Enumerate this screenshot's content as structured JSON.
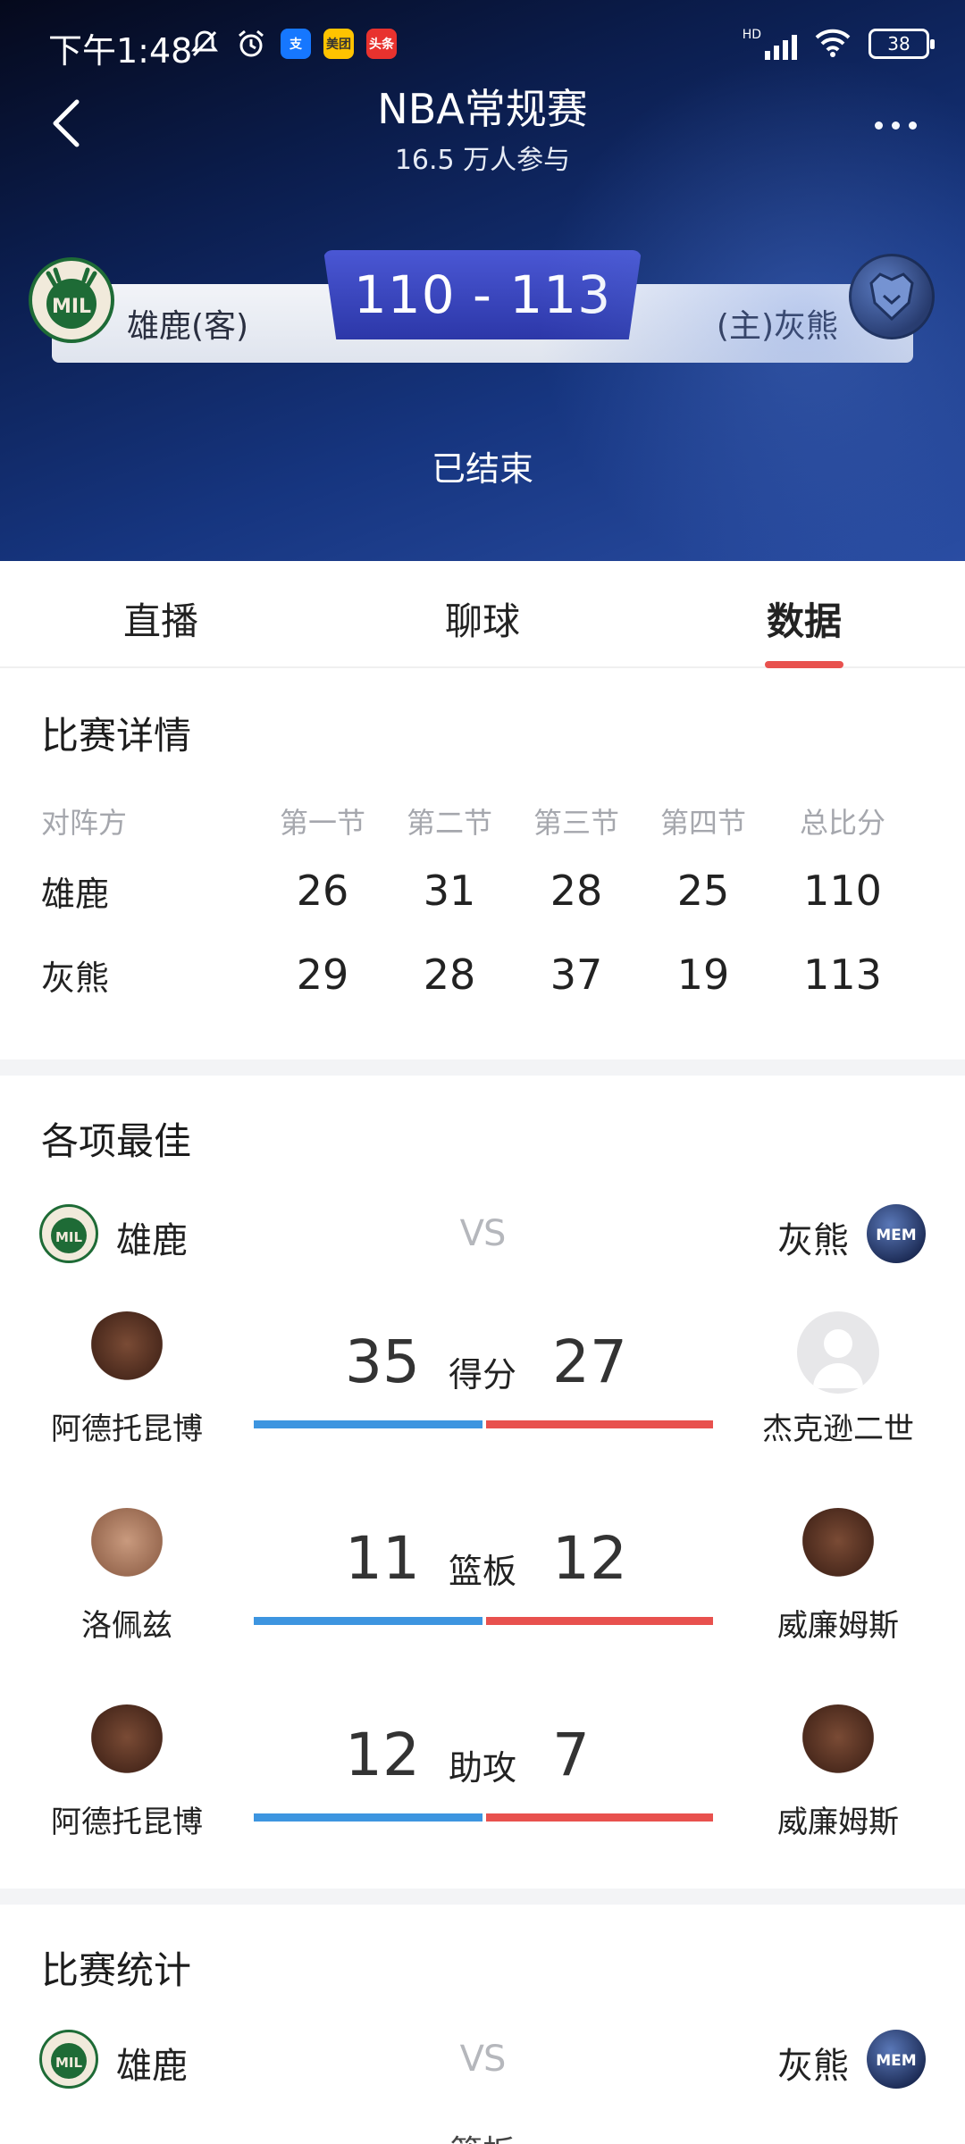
{
  "status_bar": {
    "time": "下午1:48",
    "apps": [
      "支",
      "美团",
      "头条"
    ],
    "network": "HD",
    "battery": "38"
  },
  "nav": {
    "title": "NBA常规赛",
    "subtitle": "16.5 万人参与"
  },
  "match": {
    "away_team": "雄鹿(客)",
    "home_team": "(主)灰熊",
    "score": "110 - 113",
    "status": "已结束",
    "away_logo_text": "MIL",
    "home_logo_text": "MEM"
  },
  "tabs": [
    {
      "label": "直播"
    },
    {
      "label": "聊球"
    },
    {
      "label": "数据"
    }
  ],
  "game_detail": {
    "title": "比赛详情",
    "headers": [
      "对阵方",
      "第一节",
      "第二节",
      "第三节",
      "第四节",
      "总比分"
    ],
    "rows": [
      {
        "team": "雄鹿",
        "q": [
          "26",
          "31",
          "28",
          "25",
          "110"
        ]
      },
      {
        "team": "灰熊",
        "q": [
          "29",
          "28",
          "37",
          "19",
          "113"
        ]
      }
    ]
  },
  "leaders": {
    "title": "各项最佳",
    "left_team": "雄鹿",
    "right_team": "灰熊",
    "vs": "VS",
    "items": [
      {
        "label": "得分",
        "left_value": "35",
        "right_value": "27",
        "left_player": "阿德托昆博",
        "right_player": "杰克逊二世"
      },
      {
        "label": "篮板",
        "left_value": "11",
        "right_value": "12",
        "left_player": "洛佩兹",
        "right_player": "威廉姆斯"
      },
      {
        "label": "助攻",
        "left_value": "12",
        "right_value": "7",
        "left_player": "阿德托昆博",
        "right_player": "威廉姆斯"
      }
    ]
  },
  "team_stats": {
    "title": "比赛统计",
    "left_team": "雄鹿",
    "right_team": "灰熊",
    "vs": "VS",
    "first_label": "篮板"
  },
  "colors": {
    "accent_red": "#e8514e",
    "accent_blue": "#3d95e0",
    "score_badge": "#3a46c0"
  }
}
